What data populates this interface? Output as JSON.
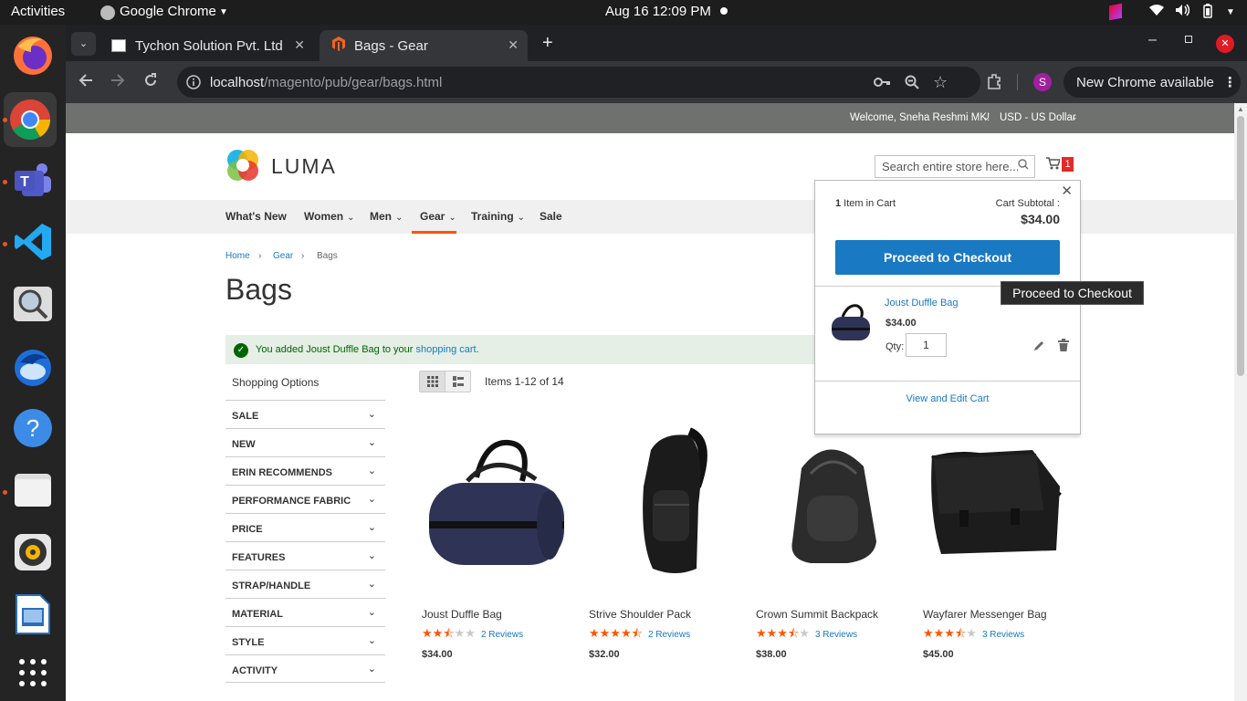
{
  "os": {
    "activities": "Activities",
    "app_name": "Google Chrome",
    "clock": "Aug 16  12:09 PM"
  },
  "tabs": [
    {
      "title": "Tychon Solution Pvt. Ltd",
      "active": false
    },
    {
      "title": "Bags - Gear",
      "active": true
    }
  ],
  "omnibox": {
    "host": "localhost",
    "path": "/magento/pub/gear/bags.html",
    "update_label": "New Chrome available",
    "profile_initial": "S"
  },
  "store": {
    "welcome": "Welcome, Sneha Reshmi MK!",
    "currency": "USD - US Dollar",
    "logo_text": "LUMA",
    "search_placeholder": "Search entire store here...",
    "cart_count": "1",
    "nav": [
      "What's New",
      "Women",
      "Men",
      "Gear",
      "Training",
      "Sale"
    ],
    "breadcrumbs": [
      "Home",
      "Gear",
      "Bags"
    ],
    "page_title": "Bags",
    "message_prefix": "You added Joust Duffle Bag to your ",
    "message_link": "shopping cart",
    "message_suffix": ".",
    "shopping_options": "Shopping Options",
    "filters": [
      "SALE",
      "NEW",
      "ERIN RECOMMENDS",
      "PERFORMANCE FABRIC",
      "PRICE",
      "FEATURES",
      "STRAP/HANDLE",
      "MATERIAL",
      "STYLE",
      "ACTIVITY"
    ],
    "amount": "Items 1-12 of 14",
    "products": [
      {
        "name": "Joust Duffle Bag",
        "rating": 2.5,
        "reviews": "2  Reviews",
        "price": "$34.00"
      },
      {
        "name": "Strive Shoulder Pack",
        "rating": 4.5,
        "reviews": "2  Reviews",
        "price": "$32.00"
      },
      {
        "name": "Crown Summit Backpack",
        "rating": 3.5,
        "reviews": "3  Reviews",
        "price": "$38.00"
      },
      {
        "name": "Wayfarer Messenger Bag",
        "rating": 3.5,
        "reviews": "3  Reviews",
        "price": "$45.00"
      }
    ]
  },
  "minicart": {
    "count": "1",
    "items_label": " Item in Cart",
    "subtotal_label": "Cart Subtotal :",
    "subtotal": "$34.00",
    "checkout_label": "Proceed to Checkout",
    "item_name": "Joust Duffle Bag",
    "item_price": "$34.00",
    "qty_label": "Qty:",
    "qty": "1",
    "view_edit": "View and Edit Cart"
  },
  "tooltip": "Proceed to Checkout",
  "colors": {
    "accent": "#1979c3",
    "star": "#ff5501",
    "nav_active": "#ff5501"
  }
}
